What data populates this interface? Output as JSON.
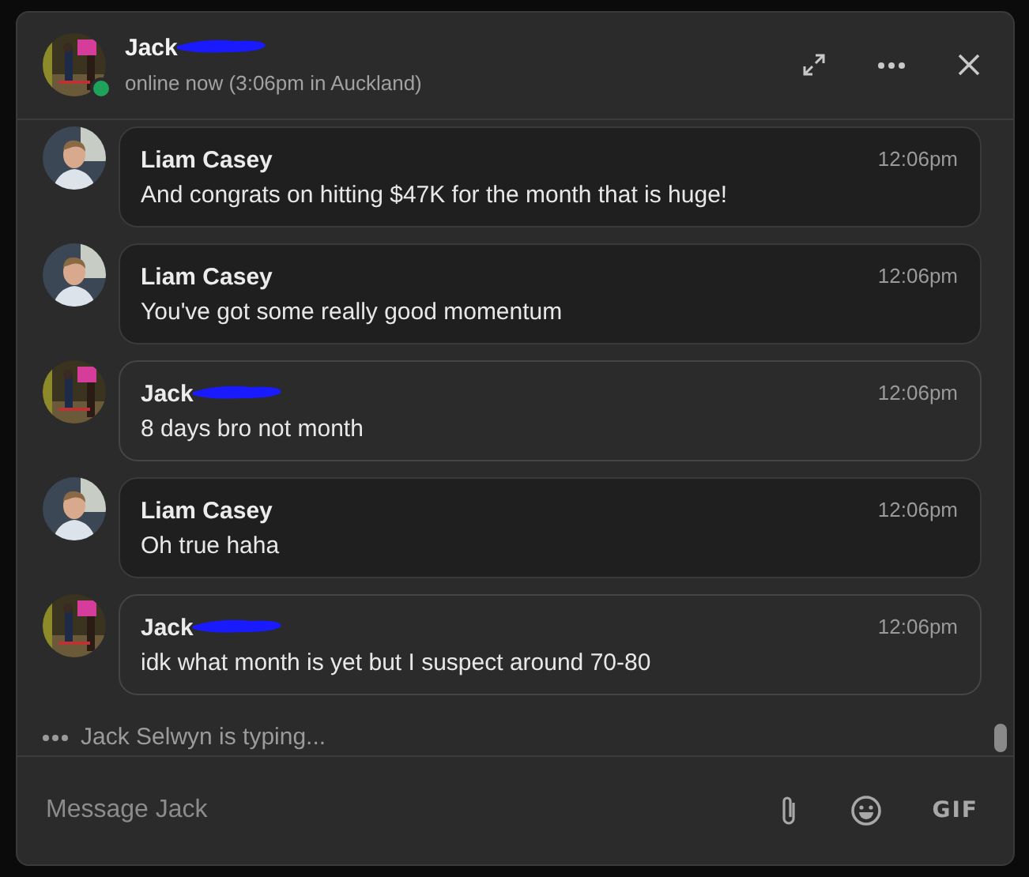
{
  "header": {
    "name": "Jack",
    "name_redacted": true,
    "online": true,
    "status": "online now (3:06pm in Auckland)"
  },
  "messages": [
    {
      "sender": "Liam Casey",
      "redacted": false,
      "outgoing": true,
      "time": "12:06pm",
      "text": "And congrats on hitting $47K for the month that is huge!"
    },
    {
      "sender": "Liam Casey",
      "redacted": false,
      "outgoing": true,
      "time": "12:06pm",
      "text": "You've got some really good momentum"
    },
    {
      "sender": "Jack",
      "redacted": true,
      "outgoing": false,
      "time": "12:06pm",
      "text": "8 days bro not month"
    },
    {
      "sender": "Liam Casey",
      "redacted": false,
      "outgoing": true,
      "time": "12:06pm",
      "text": "Oh true haha"
    },
    {
      "sender": "Jack",
      "redacted": true,
      "outgoing": false,
      "time": "12:06pm",
      "text": "idk what month is yet but I suspect around 70-80"
    }
  ],
  "typing": "Jack Selwyn is typing...",
  "composer": {
    "placeholder": "Message Jack",
    "gif_label": "GIF"
  }
}
